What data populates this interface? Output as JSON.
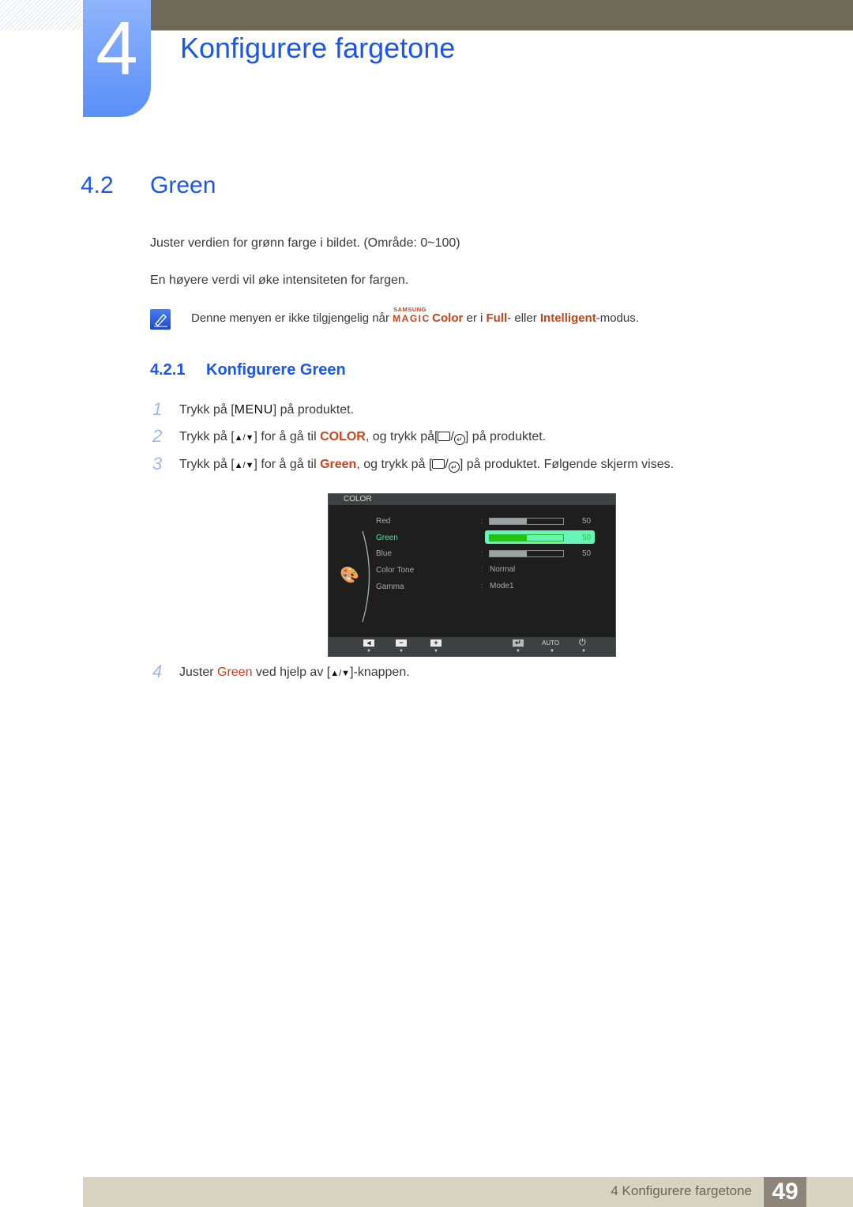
{
  "chapter": {
    "number": "4",
    "title": "Konfigurere fargetone"
  },
  "section": {
    "number": "4.2",
    "title": "Green"
  },
  "paragraphs": [
    "Juster verdien for grønn farge i bildet. (Område: 0~100)",
    "En høyere verdi vil øke intensiteten for fargen."
  ],
  "note": {
    "icon": "note-pencil-icon",
    "text_before": "Denne menyen er ikke tilgjengelig når ",
    "magic_top": "SAMSUNG",
    "magic_bottom": "MAGIC",
    "color_word": "Color",
    "text_mid1": " er i ",
    "full_word": "Full",
    "text_mid2": "- eller ",
    "intelligent_word": "Intelligent",
    "text_end": "-modus."
  },
  "subsection": {
    "number": "4.2.1",
    "title": "Konfigurere Green"
  },
  "steps": [
    {
      "num": "1",
      "pre": "Trykk på [",
      "key": "MENU",
      "post": "] på produktet."
    },
    {
      "num": "2",
      "pre": "Trykk på [",
      "keys": "▲/▼",
      "mid": "] for å gå til ",
      "highlight": "COLOR",
      "mid2": ", og trykk på[",
      "post": "] på produktet."
    },
    {
      "num": "3",
      "pre": "Trykk på [",
      "keys": "▲/▼",
      "mid": "] for å gå til ",
      "highlight": "Green",
      "mid2": ", og trykk på [",
      "post": "] på produktet. Følgende skjerm vises."
    },
    {
      "num": "4",
      "pre": "Juster ",
      "highlight": "Green",
      "mid": " ved hjelp av [",
      "keys": "▲/▼",
      "post": "]-knappen."
    }
  ],
  "osd": {
    "title": "COLOR",
    "items": [
      {
        "label": "Red",
        "type": "bar",
        "value": "50",
        "level": 0.5,
        "active": false
      },
      {
        "label": "Green",
        "type": "bar",
        "value": "50",
        "level": 0.5,
        "active": true
      },
      {
        "label": "Blue",
        "type": "bar",
        "value": "50",
        "level": 0.5,
        "active": false
      },
      {
        "label": "Color Tone",
        "type": "text",
        "value": "Normal",
        "active": false
      },
      {
        "label": "Gamma",
        "type": "text",
        "value": "Mode1",
        "active": false
      }
    ],
    "footer": {
      "left_icon": "left-arrow-icon",
      "minus_icon": "minus-icon",
      "plus_icon": "plus-icon",
      "enter_icon": "enter-icon",
      "auto_label": "AUTO",
      "power_icon": "power-icon"
    },
    "colors": {
      "active_text": "#5ee0a0",
      "highlight_bg": "#66f5b6",
      "bar_fill_active": "#22c40e"
    }
  },
  "footer": {
    "text": "4 Konfigurere fargetone",
    "page": "49"
  },
  "colors": {
    "heading_blue": "#1a56f0",
    "accent_orange": "#c8451b",
    "top_bar": "#6d6b57",
    "footer_bar": "#d8d3c0",
    "page_box": "#8e857a"
  }
}
